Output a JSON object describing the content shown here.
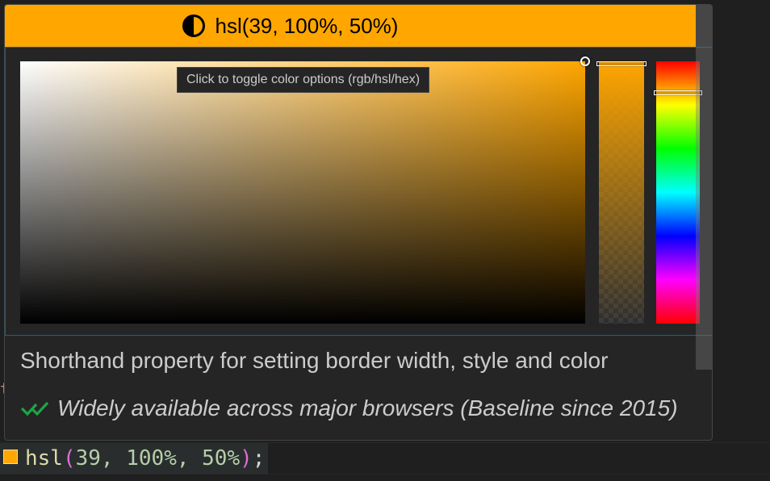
{
  "picker": {
    "header_label": "hsl(39, 100%, 50%)",
    "header_icon": "contrast-icon",
    "tooltip": "Click to toggle color options (rgb/hsl/hex)",
    "color_hex": "#ffa600",
    "hue_color": "#ffa600",
    "saturation_fraction": 1.0,
    "brightness_fraction": 1.0,
    "opacity_fraction": 1.0,
    "hue_fraction": 0.11
  },
  "hover": {
    "description": "Shorthand property for setting border width, style and color",
    "baseline_icon": "baseline-check-icon",
    "baseline_text": "Widely available across major browsers (Baseline since 2015)"
  },
  "code": {
    "fn": "hsl",
    "open_paren": "(",
    "args": "39, 100%, 50%",
    "close_paren": ")",
    "terminator": ";"
  },
  "colors": {
    "fn": "#dcdcaa",
    "paren": "#da70d6",
    "args": "#b5cea8",
    "punct": "#d4d4d4"
  }
}
